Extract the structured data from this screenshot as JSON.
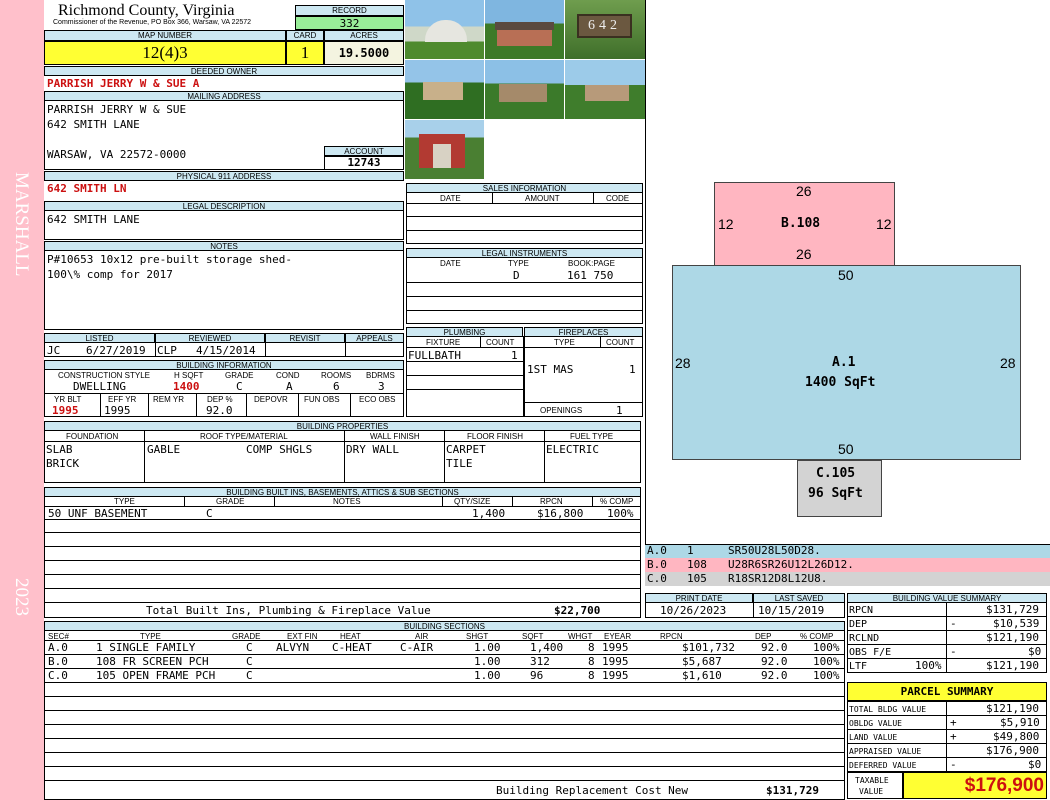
{
  "county": {
    "title": "Richmond County, Virginia",
    "subtitle": "Commissioner of the Revenue, PO Box 366, Warsaw, VA 22572",
    "district": "MARSHALL",
    "year": "2023"
  },
  "record": {
    "record_label": "RECORD",
    "record": "332",
    "map_label": "MAP NUMBER",
    "map_number": "12(4)3",
    "card_label": "CARD",
    "card": "1",
    "acres_label": "ACRES",
    "acres": "19.5000"
  },
  "owner": {
    "deeded_label": "DEEDED OWNER",
    "deeded_owner": "PARRISH JERRY W & SUE A",
    "mailing_label": "MAILING ADDRESS",
    "mail_line1": "PARRISH JERRY W & SUE",
    "mail_line2": "642 SMITH LANE",
    "mail_line3": "WARSAW, VA 22572-0000",
    "account_label": "ACCOUNT",
    "account": "12743",
    "physical_label": "PHYSICAL 911 ADDRESS",
    "physical": "642 SMITH LN",
    "legal_label": "LEGAL DESCRIPTION",
    "legal": "642 SMITH LANE",
    "notes_label": "NOTES",
    "notes_line1": "P#10653 10x12 pre-built storage shed-",
    "notes_line2": "100\\% comp for 2017"
  },
  "review": {
    "listed_label": "LISTED",
    "listed_by": "JC",
    "listed_date": "6/27/2019",
    "reviewed_label": "REVIEWED",
    "reviewed_by": "CLP",
    "reviewed_date": "4/15/2014",
    "revisit_label": "REVISIT",
    "appeals_label": "APPEALS"
  },
  "building_info": {
    "label": "BUILDING INFORMATION",
    "h1": "CONSTRUCTION STYLE",
    "h2": "H SQFT",
    "h3": "GRADE",
    "h4": "COND",
    "h5": "ROOMS",
    "h6": "BDRMS",
    "style": "DWELLING",
    "hsqft": "1400",
    "grade": "C",
    "cond": "A",
    "rooms": "6",
    "bdrms": "3",
    "g1": "YR BLT",
    "g2": "EFF YR",
    "g3": "REM YR",
    "g4": "DEP %",
    "g5": "DEPOVR",
    "g6": "FUN OBS",
    "g7": "ECO OBS",
    "yrblt": "1995",
    "effyr": "1995",
    "dep": "92.0"
  },
  "sales": {
    "label": "SALES INFORMATION",
    "h_date": "DATE",
    "h_amount": "AMOUNT",
    "h_code": "CODE"
  },
  "legal_instr": {
    "label": "LEGAL INSTRUMENTS",
    "h_date": "DATE",
    "h_type": "TYPE",
    "h_book": "BOOK:PAGE",
    "type": "D",
    "book": "161 750"
  },
  "plumbing": {
    "label": "PLUMBING",
    "h_fixture": "FIXTURE",
    "h_count": "COUNT",
    "fixture": "FULLBATH",
    "count": "1"
  },
  "fireplaces": {
    "label": "FIREPLACES",
    "h_type": "TYPE",
    "h_count": "COUNT",
    "type": "1ST MAS",
    "count": "1",
    "openings_label": "OPENINGS",
    "openings": "1"
  },
  "properties": {
    "label": "BUILDING PROPERTIES",
    "h_found": "FOUNDATION",
    "h_roof": "ROOF TYPE/MATERIAL",
    "h_wall": "WALL FINISH",
    "h_floor": "FLOOR FINISH",
    "h_fuel": "FUEL TYPE",
    "found1": "SLAB",
    "found2": "BRICK",
    "roof_type": "GABLE",
    "roof_mat": "COMP SHGLS",
    "wall": "DRY WALL",
    "floor1": "CARPET",
    "floor2": "TILE",
    "fuel": "ELECTRIC"
  },
  "builtins": {
    "label": "BUILDING BUILT INS, BASEMENTS, ATTICS & SUB SECTIONS",
    "h_type": "TYPE",
    "h_grade": "GRADE",
    "h_notes": "NOTES",
    "h_qty": "QTY/SIZE",
    "h_rpcn": "RPCN",
    "h_comp": "% COMP",
    "r_type": "50 UNF BASEMENT",
    "r_grade": "C",
    "r_qty": "1,400",
    "r_rpcn": "$16,800",
    "r_comp": "100%",
    "total_label": "Total Built Ins, Plumbing & Fireplace Value",
    "total": "$22,700"
  },
  "print": {
    "print_label": "PRINT DATE",
    "print_date": "10/26/2023",
    "saved_label": "LAST SAVED",
    "saved_date": "10/15/2019"
  },
  "sections": {
    "label": "BUILDING SECTIONS",
    "h": [
      "SEC#",
      "TYPE",
      "GRADE",
      "EXT FIN",
      "HEAT",
      "AIR",
      "SHGT",
      "SQFT",
      "WHGT",
      "EYEAR",
      "RPCN",
      "DEP",
      "% COMP"
    ],
    "rows": [
      {
        "sec": "A.0",
        "type": "1 SINGLE FAMILY",
        "grade": "C",
        "ext": "ALVYN",
        "heat": "C-HEAT",
        "air": "C-AIR",
        "shgt": "1.00",
        "sqft": "1,400",
        "whgt": "8",
        "eyear": "1995",
        "rpcn": "$101,732",
        "dep": "92.0",
        "comp": "100%"
      },
      {
        "sec": "B.0",
        "type": "108 FR SCREEN PCH",
        "grade": "C",
        "ext": "",
        "heat": "",
        "air": "",
        "shgt": "1.00",
        "sqft": "312",
        "whgt": "8",
        "eyear": "1995",
        "rpcn": "$5,687",
        "dep": "92.0",
        "comp": "100%"
      },
      {
        "sec": "C.0",
        "type": "105 OPEN FRAME PCH",
        "grade": "C",
        "ext": "",
        "heat": "",
        "air": "",
        "shgt": "1.00",
        "sqft": "96",
        "whgt": "8",
        "eyear": "1995",
        "rpcn": "$1,610",
        "dep": "92.0",
        "comp": "100%"
      }
    ],
    "total_label": "Building Replacement Cost New",
    "total": "$131,729"
  },
  "sketch": {
    "b_label": "B.108",
    "b_top": "26",
    "b_bottom": "26",
    "b_left": "12",
    "b_right": "12",
    "a_label": "A.1",
    "a_area": "1400 SqFt",
    "a_top": "50",
    "a_bottom": "50",
    "a_left": "28",
    "a_right": "28",
    "c_label": "C.105",
    "c_area": "96 SqFt",
    "lines": [
      {
        "sec": "A.0",
        "code": "1",
        "path": "SR50U28L50D28."
      },
      {
        "sec": "B.0",
        "code": "108",
        "path": "U28R6SR26U12L26D12."
      },
      {
        "sec": "C.0",
        "code": "105",
        "path": "R18SR12D8L12U8."
      }
    ]
  },
  "bvs": {
    "label": "BUILDING VALUE SUMMARY",
    "rpcn_l": "RPCN",
    "rpcn": "$131,729",
    "dep_l": "DEP",
    "dep_s": "-",
    "dep": "$10,539",
    "rclnd_l": "RCLND",
    "rclnd": "$121,190",
    "obs_l": "OBS F/E",
    "obs_s": "-",
    "obs": "$0",
    "ltr_l": "LTF",
    "ltr_p": "100%",
    "ltr": "$121,190"
  },
  "parcel": {
    "label": "PARCEL SUMMARY",
    "tbv_l": "TOTAL BLDG VALUE",
    "tbv": "$121,190",
    "obldg_l": "OBLDG VALUE",
    "obldg_s": "+",
    "obldg": "$5,910",
    "land_l": "LAND VALUE",
    "land_s": "+",
    "land": "$49,800",
    "appr_l": "APPRAISED VALUE",
    "appr": "$176,900",
    "def_l": "DEFERRED VALUE",
    "def_s": "-",
    "def": "$0",
    "taxable_l1": "TAXABLE",
    "taxable_l2": "VALUE",
    "taxable": "$176,900"
  },
  "photos": {
    "number_sign": "642"
  },
  "colors": {
    "pink": "#ffb6c1",
    "yellow": "#ffff33",
    "green": "#99ee99",
    "blue": "#add8e6",
    "gray": "#d3d3d3"
  }
}
